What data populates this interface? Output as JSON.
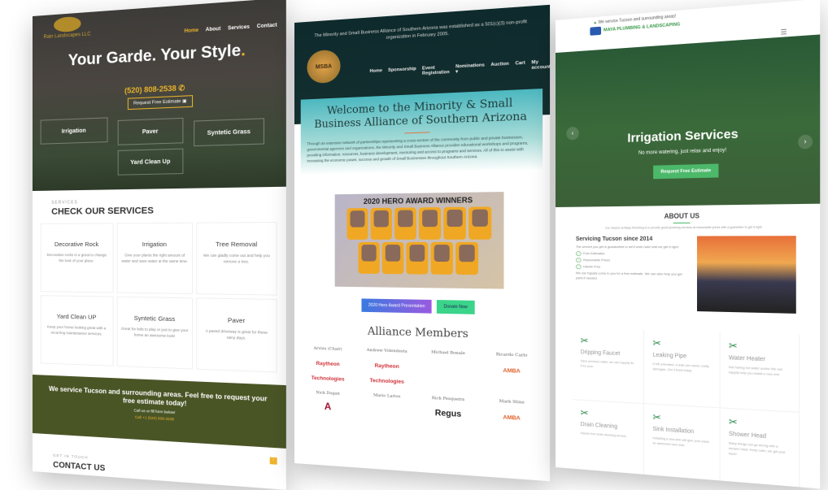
{
  "landscape": {
    "logo": "Rain Landscapes LLC",
    "nav": [
      "Home",
      "About",
      "Services",
      "Contact"
    ],
    "hero_title": "Your Garde. Your Style",
    "hero_dot": ".",
    "phone": "(520) 808-2538 ✆",
    "estimate_button": "Request Free Estimate ▣",
    "hero_boxes": [
      "Irrigation",
      "Paver",
      "Syntetic Grass",
      "Yard Clean Up"
    ],
    "services_label": "SERVICES",
    "services_heading": "CHECK OUR SERVICES",
    "services": [
      {
        "title": "Decorative Rock",
        "text": "Decorative rocks is a great to change the look of your place."
      },
      {
        "title": "Irrigation",
        "text": "Give your plants the right amount of water and save water at the same time."
      },
      {
        "title": "Tree Removal",
        "text": "We can gladly come out and help you remove a tree."
      },
      {
        "title": "Yard Clean UP",
        "text": "Keep your home looking great with a recurring maintenance services."
      },
      {
        "title": "Syntetic Grass",
        "text": "Great for kids to play or just to give your home an awesome look!"
      },
      {
        "title": "Paver",
        "text": "A paved driveway is great for these rainy days."
      }
    ],
    "band_title": "We service Tucson and surrounding areas. Feel free to request your free estimate today!",
    "band_sub": "Call us or fill form below!",
    "band_call": "Call +1 (520) 808-2538",
    "contact_label": "GET IN TOUCH",
    "contact_heading": "CONTACT US",
    "top_icon": "↑"
  },
  "alliance": {
    "announcement": "The Minority and Small Business Alliance of Southern Arizona was established as a 501(c)(3) non-profit organization in February 2005.",
    "logo": "MSBA",
    "nav": [
      "Home",
      "Sponsorship",
      "Event Registration",
      "Nominations ▾",
      "Auction",
      "Cart",
      "My account"
    ],
    "welcome": "Welcome to the Minority & Small Business Alliance of Southern Arizona",
    "intro": "Through an extensive network of partnerships representing a cross-section of the community from public and private businesses, governmental agencies and organizations, the Minority and Small Business Alliance provides educational workshops and programs, providing information, resources, business development, mentoring and access to programs and services. All of this to assist with increasing the economic power, success and growth of Small Businesses throughout Southern Arizona.",
    "award_title": "2020 HERO AWARD WINNERS",
    "presentation_button": "2020 Hero Award Presentation",
    "donate_button": "Donate Now",
    "members_heading": "Alliance Members",
    "members": [
      {
        "name": "Arvizu (Chair)",
        "logo": "Raytheon Technologies",
        "cls": "ray"
      },
      {
        "name": "Andrew Volendesta",
        "logo": "Raytheon Technologies",
        "cls": "ray"
      },
      {
        "name": "Michael Bonale",
        "logo": "",
        "cls": ""
      },
      {
        "name": "Ricardo Carlo",
        "logo": "AMBA",
        "cls": "amb"
      },
      {
        "name": "Nick Dugan",
        "logo": "A",
        "cls": "ua"
      },
      {
        "name": "Mario Larios",
        "logo": "",
        "cls": ""
      },
      {
        "name": "Rich Pesqueira",
        "logo": "Regus",
        "cls": "reg"
      },
      {
        "name": "Mark Stine",
        "logo": "AMBA",
        "cls": "amb"
      }
    ]
  },
  "plumbing": {
    "topbar": "We service Tucson and surrounding areas!",
    "logo": "MAYA PLUMBING & LANDSCAPING",
    "menu_icon": "☰",
    "hero_title": "Irrigation Services",
    "hero_sub": "No more watering, just relax and enjoy!",
    "hero_button": "Request Free Estimate",
    "prev": "‹",
    "next": "›",
    "about_heading": "ABOUT US",
    "about_text": "Our mission at Maya Plumbing is to provide great plumbing services at reasonable prices with a guarantee to get it right.",
    "since_heading": "Servicing Tucson since 2014",
    "since_italic": "The service you get is guaranteed or we'll work hard until we get it right.",
    "features": [
      "Free Estimates",
      "Reasonable Prices",
      "Hassle Free"
    ],
    "since_text": "We can happily come to you for a free estimate. We can also help you get parts if needed.",
    "services": [
      {
        "title": "Dripping Faucet",
        "text": "Save precious water, we can happily fix it for your."
      },
      {
        "title": "Leaking Pipe",
        "text": "If left untreated, a leak can cause costly damages. Get it fixed today."
      },
      {
        "title": "Water Heater",
        "text": "Not having hot water sucks! We can happily help you install a new one."
      },
      {
        "title": "Drain Cleaning",
        "text": "Hassle free drain cleaning service."
      },
      {
        "title": "Sink Installation",
        "text": "Installing a new sink will give your place an awesome new look."
      },
      {
        "title": "Shower Head",
        "text": "Many things can go wrong with a shower head. Keep calm, we got your back!"
      }
    ],
    "tool_icon": "✂"
  }
}
